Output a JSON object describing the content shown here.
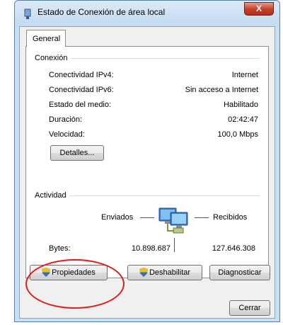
{
  "window": {
    "title": "Estado de Conexión de área local",
    "close_glyph": "X"
  },
  "tabs": [
    {
      "label": "General"
    }
  ],
  "connection": {
    "group_label": "Conexión",
    "rows": [
      {
        "label": "Conectividad IPv4:",
        "value": "Internet"
      },
      {
        "label": "Conectividad IPv6:",
        "value": "Sin acceso a Internet"
      },
      {
        "label": "Estado del medio:",
        "value": "Habilitado"
      },
      {
        "label": "Duración:",
        "value": "02:42:47"
      },
      {
        "label": "Velocidad:",
        "value": "100,0 Mbps"
      }
    ],
    "details_button": "Detalles..."
  },
  "activity": {
    "group_label": "Actividad",
    "sent_label": "Enviados",
    "received_label": "Recibidos",
    "bytes_label": "Bytes:",
    "bytes_sent": "10.898.687",
    "bytes_received": "127.646.308"
  },
  "buttons": {
    "properties": "Propiedades",
    "disable": "Deshabilitar",
    "diagnose": "Diagnosticar",
    "close": "Cerrar"
  },
  "icons": {
    "title": "network-adapter-icon",
    "activity": "network-computers-icon",
    "shield": "uac-shield-icon"
  },
  "colors": {
    "annotation_circle": "#e01b1b",
    "close_button": "#c7432b"
  }
}
